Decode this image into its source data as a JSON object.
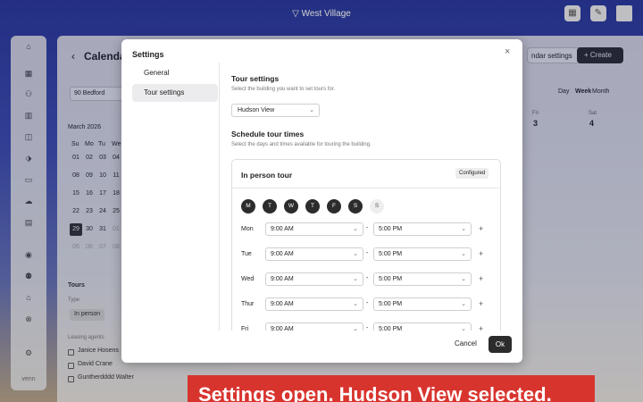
{
  "topbar": {
    "brand": "West Village"
  },
  "rail": {
    "footer": "venn"
  },
  "app": {
    "title": "Calendar",
    "building_filter": "90 Bedford",
    "month": "March 2026",
    "weekday_heads": [
      "Su",
      "Mo",
      "Tu",
      "We"
    ],
    "date_rows": [
      [
        "01",
        "02",
        "03",
        "04"
      ],
      [
        "08",
        "09",
        "10",
        "11"
      ],
      [
        "15",
        "16",
        "17",
        "18"
      ],
      [
        "22",
        "23",
        "24",
        "25"
      ],
      [
        "29",
        "30",
        "31",
        "01"
      ],
      [
        "05",
        "06",
        "07",
        "08"
      ]
    ],
    "tours_label": "Tours",
    "type_label": "Type",
    "type_chip": "In person",
    "agents_label": "Leasing agents",
    "agents": [
      "Janice Hosens",
      "David Crane",
      "Guntherdddd Walter"
    ],
    "toolbar": {
      "calendar_settings": "ndar settings",
      "create": "Create"
    },
    "view_tabs": [
      "Day",
      "Week",
      "Month"
    ],
    "day_heads": [
      {
        "dow": "Fri",
        "num": "3"
      },
      {
        "dow": "Sat",
        "num": "4"
      }
    ]
  },
  "modal": {
    "title": "Settings",
    "nav": [
      "General",
      "Tour settings"
    ],
    "tour_settings_heading": "Tour settings",
    "tour_settings_desc": "Select the building you want to set tours for.",
    "building": "Hudson View",
    "schedule_heading": "Schedule tour times",
    "schedule_desc": "Select the days and times available for touring the building.",
    "card": {
      "title": "In person tour",
      "badge": "Configured",
      "days": [
        {
          "l": "M",
          "on": true
        },
        {
          "l": "T",
          "on": true
        },
        {
          "l": "W",
          "on": true
        },
        {
          "l": "T",
          "on": true
        },
        {
          "l": "F",
          "on": true
        },
        {
          "l": "S",
          "on": true
        },
        {
          "l": "S",
          "on": false
        }
      ],
      "rows": [
        {
          "day": "Mon",
          "start": "9:00 AM",
          "end": "5:00 PM"
        },
        {
          "day": "Tue",
          "start": "9:00 AM",
          "end": "5:00 PM"
        },
        {
          "day": "Wed",
          "start": "9:00 AM",
          "end": "5:00 PM"
        },
        {
          "day": "Thur",
          "start": "9:00 AM",
          "end": "5:00 PM"
        },
        {
          "day": "Fri",
          "start": "9:00 AM",
          "end": "5:00 PM"
        }
      ]
    },
    "cancel": "Cancel",
    "ok": "Ok"
  },
  "banner": {
    "text": "Settings open. Hudson View selected."
  }
}
